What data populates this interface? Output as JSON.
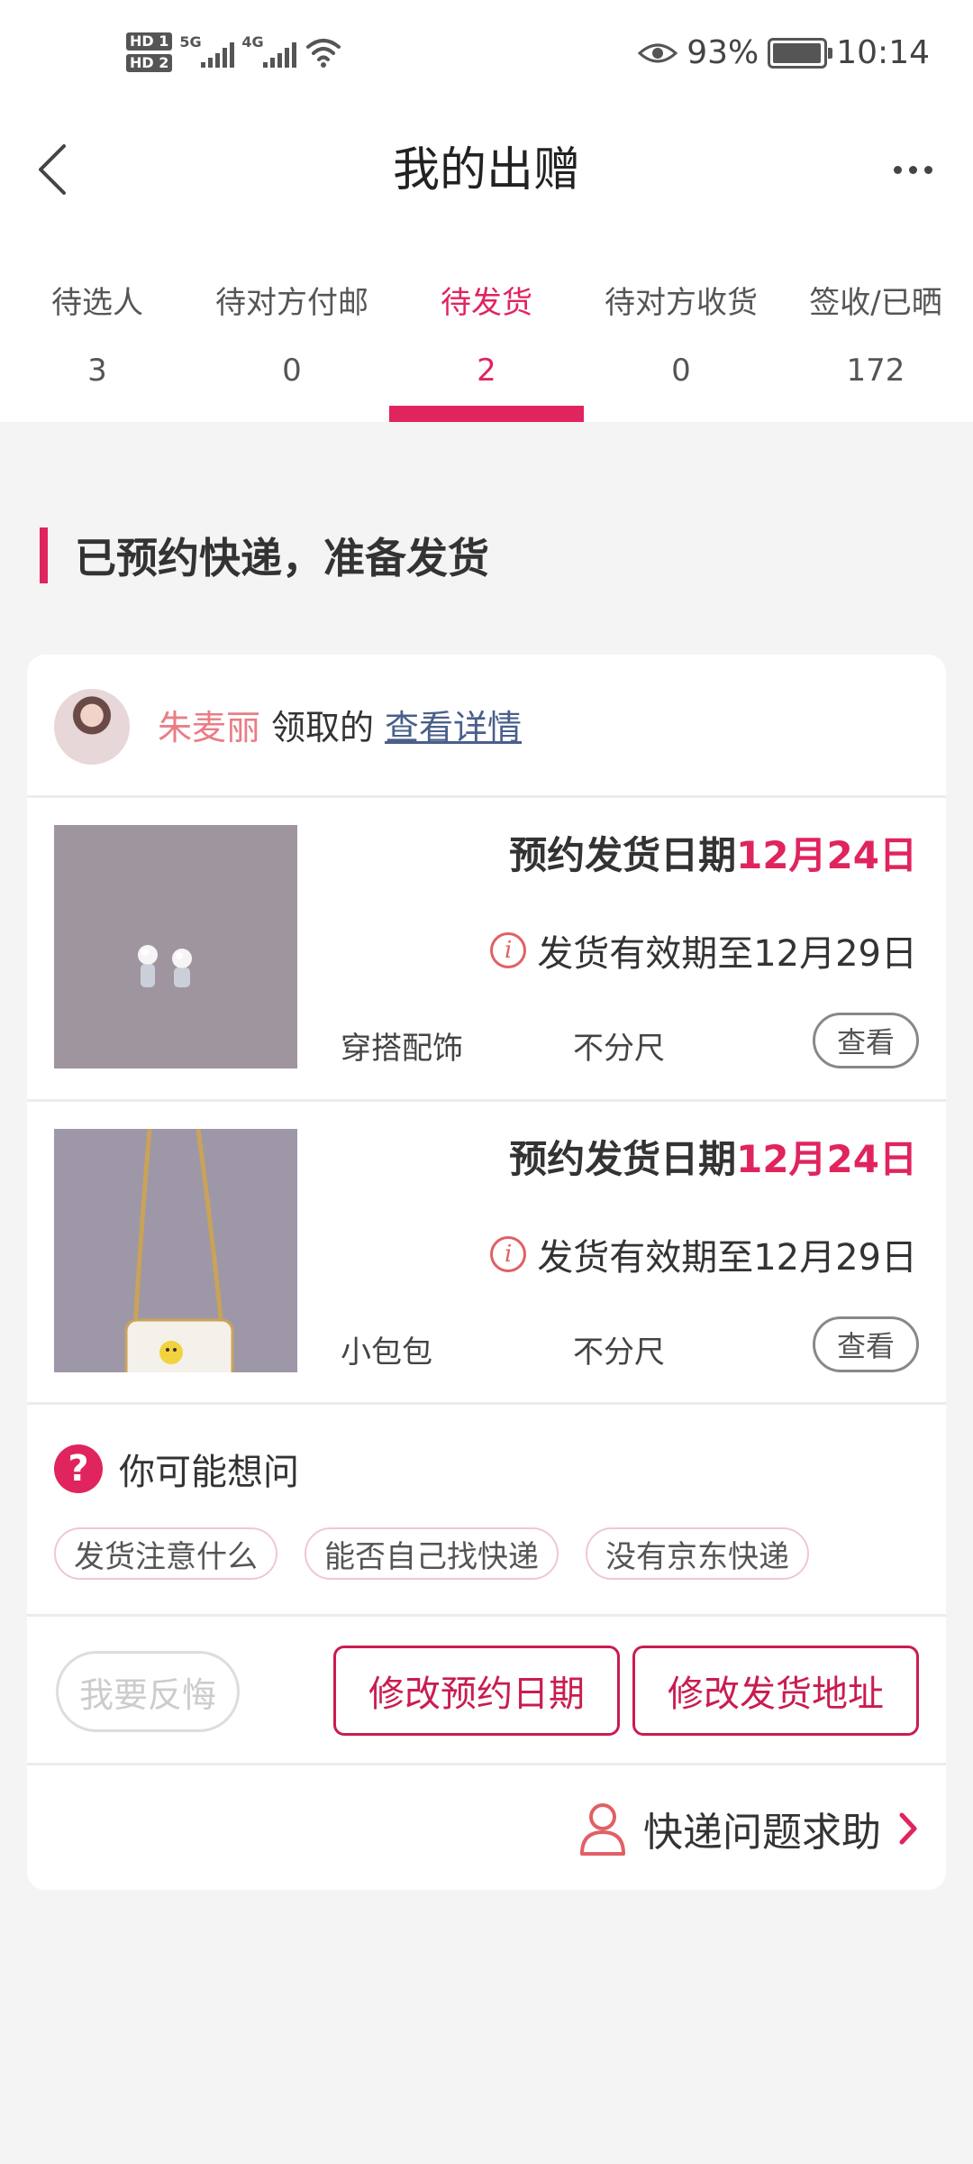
{
  "status_bar": {
    "sim1": "HD 1",
    "sim2": "HD 2",
    "net1": "5G",
    "net2": "4G",
    "battery": "93%",
    "time": "10:14"
  },
  "header": {
    "title": "我的出赠"
  },
  "tabs": [
    {
      "label": "待选人",
      "count": "3"
    },
    {
      "label": "待对方付邮",
      "count": "0"
    },
    {
      "label": "待发货",
      "count": "2",
      "active": true
    },
    {
      "label": "待对方收货",
      "count": "0"
    },
    {
      "label": "签收/已晒",
      "count": "172"
    }
  ],
  "section": {
    "title": "已预约快递，准备发货"
  },
  "receiver": {
    "name": "朱麦丽",
    "suffix": "领取的",
    "detail_link": "查看详情"
  },
  "items": [
    {
      "ship_label": "预约发货日期",
      "ship_date": "12月24日",
      "validity": "发货有效期至12月29日",
      "category": "穿搭配饰",
      "size": "不分尺",
      "view_label": "查看"
    },
    {
      "ship_label": "预约发货日期",
      "ship_date": "12月24日",
      "validity": "发货有效期至12月29日",
      "category": "小包包",
      "size": "不分尺",
      "view_label": "查看"
    }
  ],
  "faq": {
    "title": "你可能想问",
    "chips": [
      "发货注意什么",
      "能否自己找快递",
      "没有京东快递"
    ]
  },
  "actions": {
    "regret": "我要反悔",
    "edit_date": "修改预约日期",
    "edit_address": "修改发货地址"
  },
  "help": {
    "label": "快递问题求助"
  },
  "colors": {
    "accent": "#e0245e",
    "button_border": "#c91d4f",
    "link": "#4a5f8a",
    "receiver_name": "#e97d85"
  }
}
